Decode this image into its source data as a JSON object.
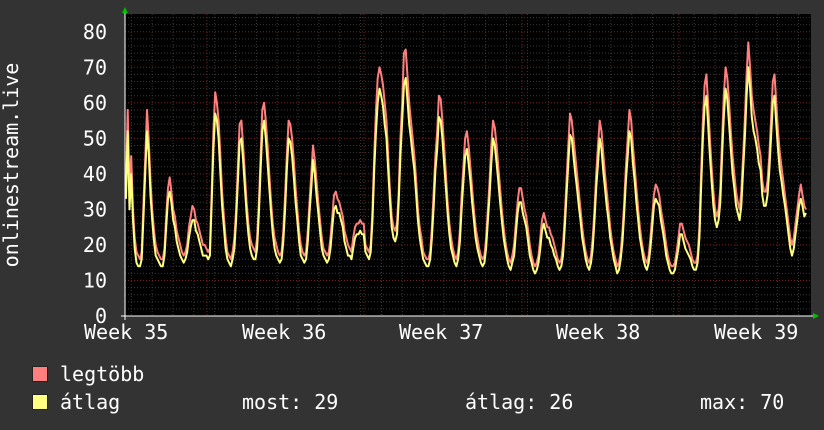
{
  "chart_data": {
    "type": "line",
    "ylabel": "onlinestream.live",
    "ylim": [
      0,
      85
    ],
    "yticks": [
      0,
      10,
      20,
      30,
      40,
      50,
      60,
      70,
      80
    ],
    "grid": true,
    "x_tick_labels": [
      "Week 35",
      "Week 36",
      "Week 37",
      "Week 38",
      "Week 39"
    ],
    "series": [
      {
        "name": "legtöbb",
        "color": "#ff7f7f",
        "values": [
          36,
          58,
          35,
          45,
          30,
          22,
          18,
          17,
          16,
          18,
          32,
          44,
          58,
          50,
          38,
          30,
          24,
          20,
          18,
          17,
          16,
          16,
          19,
          28,
          36,
          39,
          35,
          30,
          28,
          24,
          22,
          20,
          18,
          17,
          18,
          20,
          25,
          28,
          31,
          30,
          27,
          26,
          24,
          22,
          20,
          20,
          19,
          18,
          19,
          35,
          52,
          63,
          60,
          55,
          45,
          35,
          28,
          22,
          18,
          17,
          16,
          18,
          22,
          30,
          42,
          54,
          55,
          48,
          40,
          32,
          26,
          22,
          20,
          19,
          18,
          22,
          32,
          45,
          58,
          60,
          55,
          48,
          40,
          32,
          26,
          22,
          20,
          18,
          17,
          18,
          24,
          34,
          45,
          55,
          54,
          50,
          44,
          36,
          30,
          24,
          20,
          18,
          17,
          18,
          24,
          32,
          40,
          48,
          44,
          38,
          32,
          27,
          22,
          19,
          18,
          17,
          18,
          22,
          28,
          34,
          35,
          33,
          32,
          30,
          28,
          24,
          22,
          20,
          19,
          18,
          22,
          25,
          26,
          26,
          27,
          26,
          26,
          20,
          19,
          18,
          20,
          30,
          45,
          58,
          67,
          70,
          68,
          65,
          60,
          55,
          45,
          35,
          28,
          25,
          24,
          26,
          35,
          50,
          60,
          74,
          75,
          68,
          60,
          55,
          50,
          45,
          38,
          30,
          25,
          22,
          18,
          17,
          16,
          16,
          18,
          25,
          35,
          45,
          52,
          62,
          61,
          55,
          48,
          40,
          32,
          26,
          22,
          19,
          17,
          16,
          18,
          24,
          34,
          42,
          50,
          52,
          48,
          42,
          36,
          30,
          25,
          22,
          19,
          17,
          16,
          17,
          22,
          30,
          38,
          48,
          55,
          53,
          48,
          42,
          36,
          30,
          25,
          21,
          18,
          16,
          15,
          17,
          20,
          26,
          32,
          36,
          36,
          33,
          30,
          28,
          24,
          20,
          17,
          15,
          14,
          15,
          17,
          22,
          27,
          29,
          27,
          25,
          25,
          23,
          22,
          20,
          18,
          16,
          15,
          16,
          20,
          28,
          38,
          48,
          57,
          55,
          50,
          45,
          40,
          35,
          30,
          25,
          21,
          18,
          16,
          15,
          17,
          22,
          30,
          40,
          48,
          55,
          52,
          46,
          40,
          35,
          30,
          25,
          21,
          18,
          16,
          14,
          15,
          18,
          24,
          32,
          42,
          50,
          58,
          55,
          48,
          42,
          36,
          30,
          25,
          21,
          18,
          16,
          15,
          17,
          22,
          28,
          34,
          37,
          36,
          34,
          30,
          27,
          24,
          20,
          17,
          15,
          14,
          14,
          15,
          18,
          22,
          26,
          26,
          24,
          22,
          21,
          20,
          18,
          16,
          15,
          15,
          17,
          25,
          40,
          55,
          65,
          68,
          60,
          50,
          42,
          35,
          30,
          28,
          30,
          36,
          50,
          62,
          70,
          67,
          60,
          52,
          45,
          40,
          35,
          32,
          30,
          35,
          45,
          55,
          68,
          77,
          70,
          62,
          58,
          55,
          52,
          48,
          45,
          38,
          35,
          35,
          38,
          45,
          55,
          66,
          68,
          60,
          52,
          46,
          42,
          38,
          34,
          30,
          26,
          22,
          20,
          22,
          26,
          30,
          34,
          37,
          34,
          31,
          30
        ]
      },
      {
        "name": "átlag",
        "color": "#ffff80",
        "values": [
          33,
          52,
          30,
          40,
          27,
          19,
          15,
          14,
          14,
          16,
          28,
          40,
          52,
          46,
          34,
          27,
          21,
          17,
          16,
          15,
          14,
          14,
          17,
          25,
          33,
          35,
          32,
          27,
          25,
          21,
          19,
          17,
          16,
          15,
          16,
          18,
          22,
          25,
          27,
          27,
          24,
          23,
          21,
          19,
          17,
          17,
          17,
          16,
          17,
          32,
          47,
          57,
          55,
          50,
          40,
          31,
          25,
          19,
          16,
          15,
          14,
          16,
          19,
          27,
          38,
          49,
          50,
          44,
          36,
          29,
          23,
          19,
          17,
          16,
          16,
          19,
          29,
          41,
          52,
          55,
          50,
          43,
          36,
          29,
          23,
          19,
          17,
          16,
          15,
          16,
          21,
          30,
          41,
          50,
          49,
          45,
          39,
          32,
          27,
          21,
          17,
          16,
          15,
          16,
          21,
          29,
          36,
          44,
          40,
          34,
          29,
          24,
          19,
          17,
          16,
          15,
          16,
          19,
          25,
          30,
          31,
          29,
          29,
          27,
          25,
          21,
          19,
          17,
          17,
          16,
          19,
          22,
          23,
          23,
          24,
          23,
          23,
          18,
          17,
          16,
          18,
          27,
          41,
          52,
          60,
          64,
          62,
          59,
          54,
          50,
          41,
          32,
          25,
          22,
          21,
          23,
          32,
          45,
          55,
          65,
          67,
          61,
          54,
          50,
          45,
          41,
          34,
          27,
          22,
          19,
          16,
          15,
          14,
          14,
          16,
          22,
          31,
          41,
          47,
          56,
          55,
          50,
          43,
          36,
          29,
          23,
          19,
          17,
          15,
          14,
          16,
          21,
          30,
          38,
          45,
          47,
          43,
          38,
          32,
          27,
          22,
          19,
          17,
          15,
          14,
          15,
          19,
          27,
          34,
          43,
          50,
          48,
          43,
          38,
          32,
          27,
          22,
          19,
          16,
          14,
          13,
          15,
          17,
          23,
          29,
          32,
          32,
          29,
          27,
          25,
          21,
          17,
          15,
          13,
          12,
          13,
          15,
          19,
          24,
          26,
          24,
          22,
          22,
          20,
          19,
          17,
          16,
          14,
          13,
          14,
          17,
          25,
          34,
          43,
          51,
          50,
          45,
          40,
          36,
          31,
          27,
          22,
          19,
          16,
          14,
          13,
          15,
          19,
          27,
          36,
          43,
          50,
          47,
          41,
          36,
          31,
          27,
          22,
          19,
          16,
          14,
          12,
          13,
          16,
          21,
          29,
          38,
          45,
          52,
          50,
          43,
          38,
          32,
          27,
          22,
          19,
          16,
          14,
          13,
          15,
          19,
          25,
          31,
          33,
          32,
          31,
          27,
          24,
          21,
          17,
          15,
          13,
          12,
          12,
          13,
          16,
          19,
          23,
          23,
          21,
          19,
          18,
          17,
          16,
          14,
          13,
          13,
          15,
          22,
          36,
          50,
          59,
          62,
          54,
          45,
          38,
          31,
          27,
          25,
          27,
          32,
          45,
          56,
          64,
          61,
          54,
          47,
          40,
          36,
          31,
          29,
          27,
          31,
          41,
          50,
          62,
          70,
          64,
          56,
          52,
          50,
          47,
          43,
          41,
          34,
          31,
          31,
          34,
          41,
          50,
          60,
          62,
          54,
          47,
          41,
          38,
          34,
          31,
          27,
          23,
          19,
          17,
          19,
          23,
          27,
          31,
          33,
          31,
          28,
          29
        ]
      }
    ]
  },
  "legend": {
    "items": [
      {
        "label": "legtöbb",
        "color": "#ff7f7f"
      },
      {
        "label": "átlag",
        "color": "#ffff80"
      }
    ],
    "stats": {
      "most": "most: 29",
      "atlag": "átlag: 26",
      "max": "max: 70"
    }
  }
}
